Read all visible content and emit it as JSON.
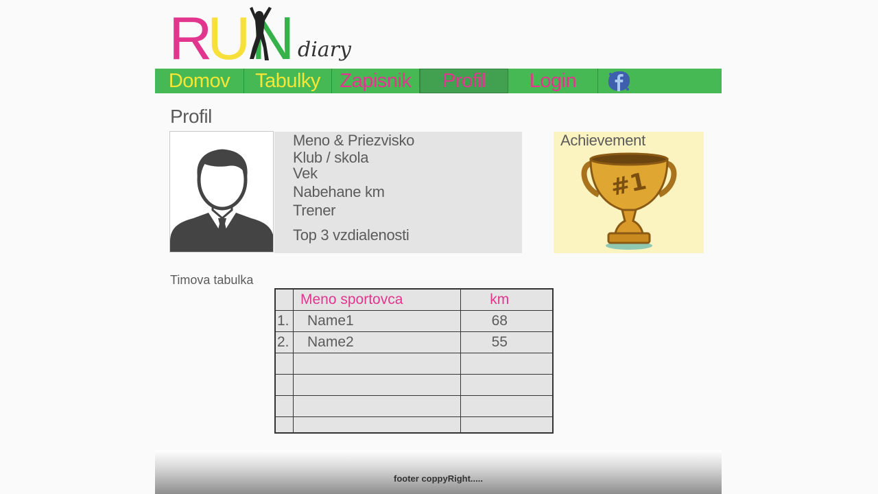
{
  "logo": {
    "letters": [
      "R",
      "U",
      "N"
    ],
    "sub": "diary"
  },
  "nav": {
    "items": [
      {
        "label": "Domov"
      },
      {
        "label": "Tabulky"
      },
      {
        "label": "Zapisnik"
      },
      {
        "label": "Profil"
      },
      {
        "label": "Login"
      }
    ]
  },
  "profile": {
    "title": "Profil",
    "fields": [
      "Meno & Priezvisko",
      "Klub / skola",
      "Vek",
      "Nabehane km",
      "Trener",
      "Top 3 vzdialenosti"
    ],
    "achievement_title": "Achievement",
    "trophy_text": "#1"
  },
  "team": {
    "title": "Timova tabulka",
    "headers": [
      "",
      "Meno sportovca",
      "km"
    ],
    "rows": [
      {
        "rank": "1.",
        "name": "Name1",
        "km": "68"
      },
      {
        "rank": "2.",
        "name": "Name2",
        "km": "55"
      },
      {
        "rank": "",
        "name": "",
        "km": ""
      },
      {
        "rank": "",
        "name": "",
        "km": ""
      },
      {
        "rank": "",
        "name": "",
        "km": ""
      },
      {
        "rank": "",
        "name": "",
        "km": ""
      }
    ]
  },
  "footer": {
    "text": "footer coppyRight....."
  },
  "colors": {
    "nav_green": "#46b854",
    "pink": "#e2358e",
    "yellow": "#f7e636",
    "logo_green": "#35b24a"
  }
}
